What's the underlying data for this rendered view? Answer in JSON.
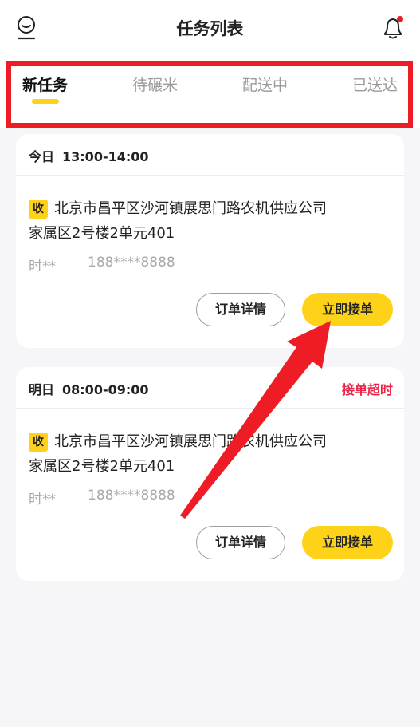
{
  "header": {
    "title": "任务列表",
    "left_icon": "user-icon",
    "right_icon": "bell-icon"
  },
  "tabs": [
    {
      "label": "新任务",
      "active": true
    },
    {
      "label": "待碾米",
      "active": false
    },
    {
      "label": "配送中",
      "active": false
    },
    {
      "label": "已送达",
      "active": false
    }
  ],
  "cards": [
    {
      "day": "今日",
      "time": "13:00-14:00",
      "status": "",
      "badge": "收",
      "address_line1": "北京市昌平区沙河镇展思门路农机供应公司",
      "address_line2": "家属区2号楼2单元401",
      "contact_name": "时**",
      "contact_phone": "188****8888",
      "detail_label": "订单详情",
      "accept_label": "立即接单"
    },
    {
      "day": "明日",
      "time": "08:00-09:00",
      "status": "接单超时",
      "badge": "收",
      "address_line1": "北京市昌平区沙河镇展思门路农机供应公司",
      "address_line2": "家属区2号楼2单元401",
      "contact_name": "时**",
      "contact_phone": "188****8888",
      "detail_label": "订单详情",
      "accept_label": "立即接单"
    }
  ],
  "colors": {
    "accent": "#ffd21a",
    "annotation": "#ee1c25",
    "status_alert": "#e8264a",
    "muted_text": "#a8a8a8"
  }
}
